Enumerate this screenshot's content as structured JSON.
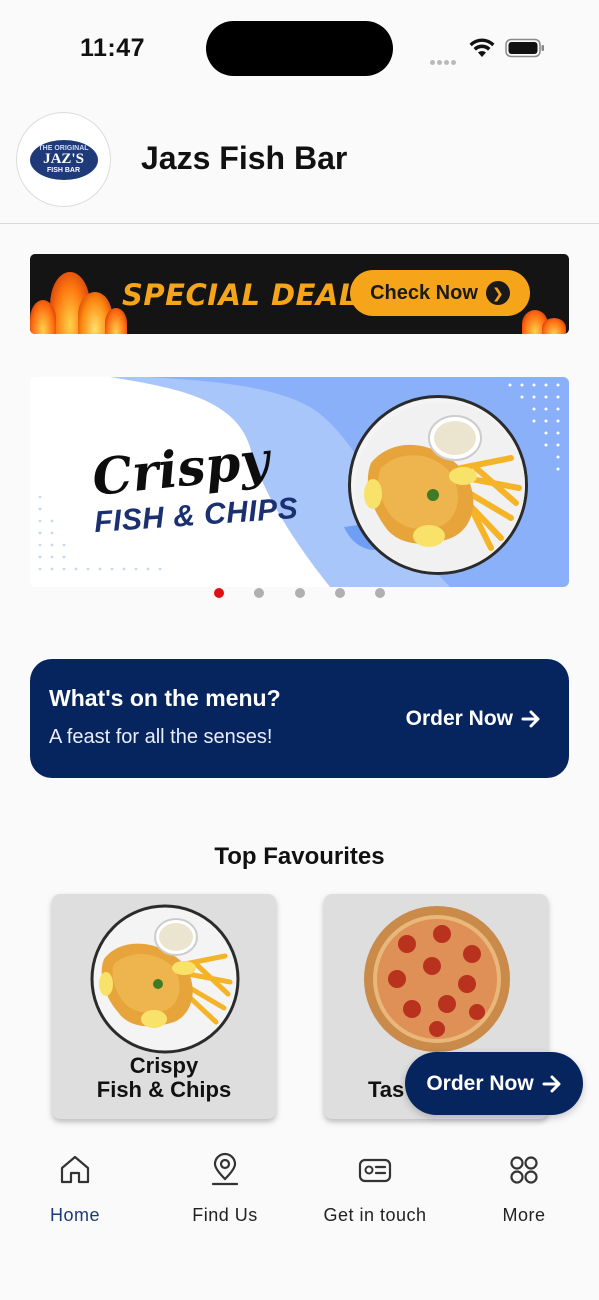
{
  "status_bar": {
    "time": "11:47"
  },
  "header": {
    "title": "Jazs Fish Bar",
    "logo_top": "THE ORIGINAL",
    "logo_mid": "JAZ'S",
    "logo_bot": "FISH BAR"
  },
  "deals_banner": {
    "text": "SPECIAL DEALS",
    "button": "Check Now"
  },
  "carousel": {
    "script": "Crispy",
    "caption": "FISH & CHIPS",
    "slide_count": 5,
    "active_index": 0
  },
  "menu_card": {
    "title": "What's on the menu?",
    "subtitle": "A feast for all the senses!",
    "action": "Order Now"
  },
  "favourites": {
    "title": "Top Favourites",
    "items": [
      {
        "line1": "Crispy",
        "line2": "Fish & Chips"
      },
      {
        "line1": "Tas",
        "line2": ""
      }
    ]
  },
  "floating_button": {
    "label": "Order Now"
  },
  "tabbar": {
    "items": [
      {
        "label": "Home",
        "icon": "home-icon",
        "active": true
      },
      {
        "label": "Find Us",
        "icon": "location-pin-icon",
        "active": false
      },
      {
        "label": "Get in touch",
        "icon": "contact-card-icon",
        "active": false
      },
      {
        "label": "More",
        "icon": "grid-icon",
        "active": false
      }
    ]
  },
  "colors": {
    "navy": "#06245e",
    "accent_orange": "#f6a51a",
    "active_dot": "#e01010",
    "tab_active": "#1a3a78"
  }
}
